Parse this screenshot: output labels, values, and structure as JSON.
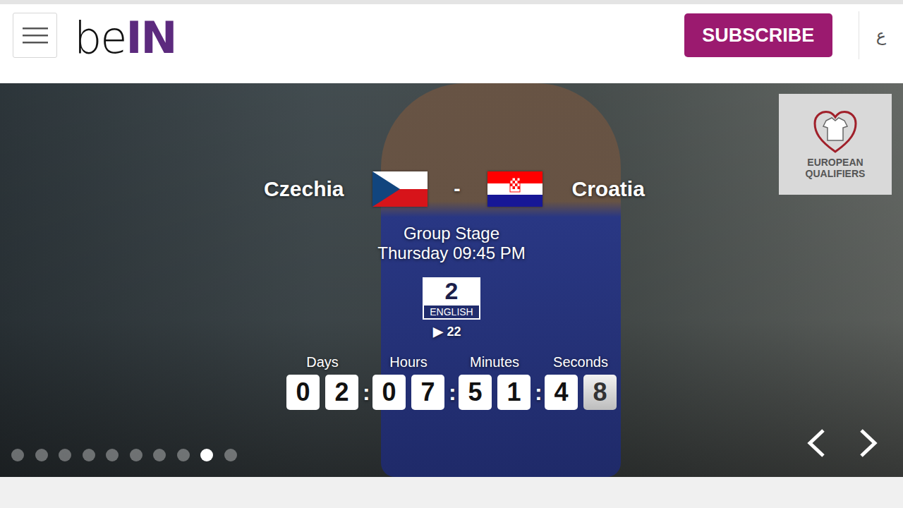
{
  "header": {
    "logo": {
      "dark": "be",
      "accent": "IN"
    },
    "subscribe": "SUBSCRIBE",
    "language": "ع"
  },
  "slide": {
    "home_team": "Czechia",
    "separator": "-",
    "away_team": "Croatia",
    "competition_badge": "EUROPEAN QUALIFIERS",
    "stage": "Group Stage",
    "kickoff": "Thursday 09:45 PM",
    "channel": {
      "number": "2",
      "language": "ENGLISH",
      "alternate": "▶ 22"
    },
    "countdown_separator": ":",
    "countdown": [
      {
        "label": "Days",
        "digits": [
          {
            "value": "0",
            "dimmed": false
          },
          {
            "value": "2",
            "dimmed": false
          }
        ]
      },
      {
        "label": "Hours",
        "digits": [
          {
            "value": "0",
            "dimmed": false
          },
          {
            "value": "7",
            "dimmed": false
          }
        ]
      },
      {
        "label": "Minutes",
        "digits": [
          {
            "value": "5",
            "dimmed": false
          },
          {
            "value": "1",
            "dimmed": false
          }
        ]
      },
      {
        "label": "Seconds",
        "digits": [
          {
            "value": "4",
            "dimmed": false
          },
          {
            "value": "8",
            "dimmed": true
          }
        ]
      }
    ]
  },
  "carousel": {
    "dots": [
      {
        "selected": false
      },
      {
        "selected": false
      },
      {
        "selected": false
      },
      {
        "selected": false
      },
      {
        "selected": false
      },
      {
        "selected": false
      },
      {
        "selected": false
      },
      {
        "selected": false
      },
      {
        "selected": true
      },
      {
        "selected": false
      }
    ]
  }
}
